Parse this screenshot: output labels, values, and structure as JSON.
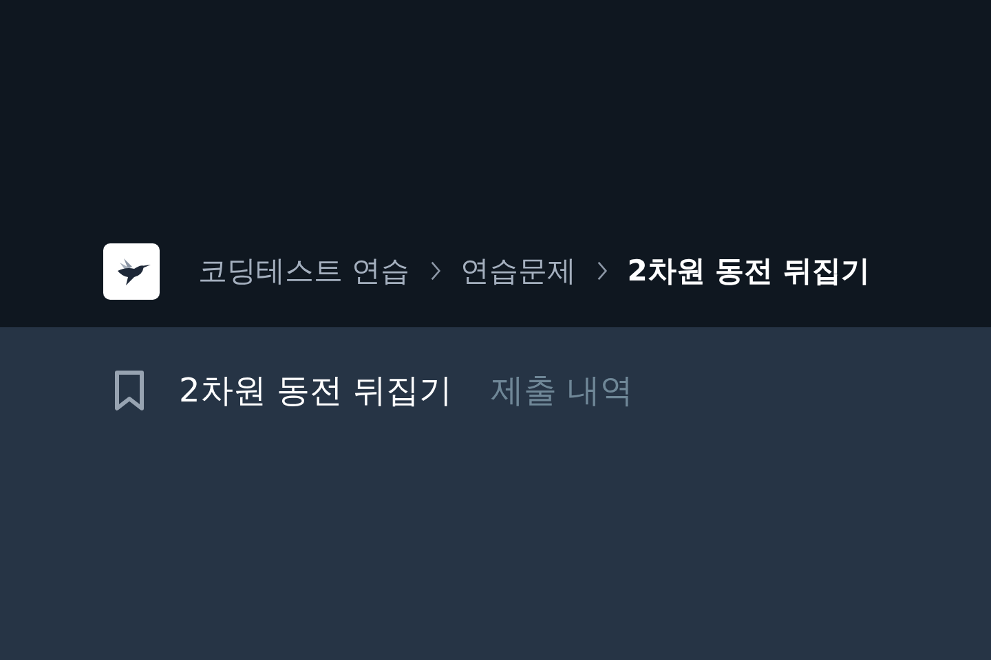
{
  "breadcrumb": [
    {
      "label": "코딩테스트 연습",
      "current": false
    },
    {
      "label": "연습문제",
      "current": false
    },
    {
      "label": "2차원 동전 뒤집기",
      "current": true
    }
  ],
  "tabs": [
    {
      "label": "2차원 동전 뒤집기",
      "selected": true
    },
    {
      "label": "제출 내역",
      "selected": false
    }
  ]
}
